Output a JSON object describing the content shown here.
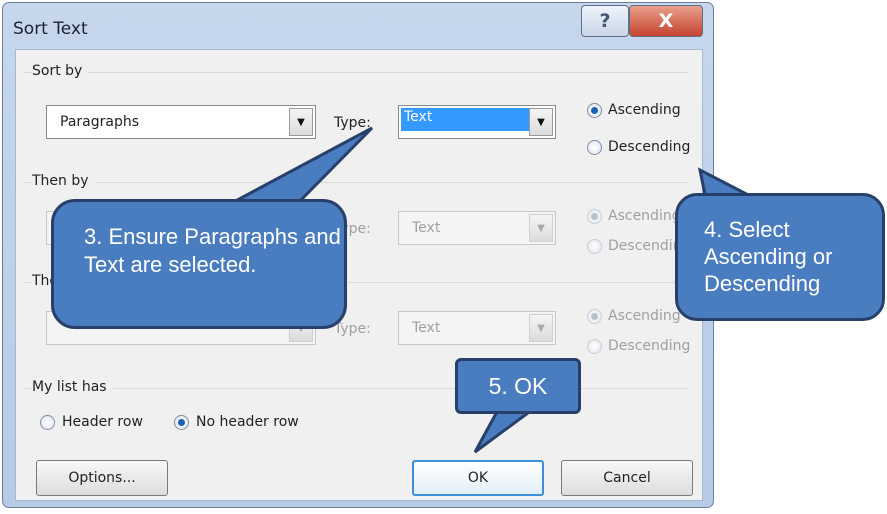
{
  "dialog": {
    "title": "Sort Text",
    "help_glyph": "?",
    "close_glyph": "X",
    "sort_by": {
      "label": "Sort by",
      "field_value": "Paragraphs",
      "type_label": "Type:",
      "type_value": "Text",
      "ascending_label": "Ascending",
      "descending_label": "Descending",
      "selected": "Ascending"
    },
    "then_by_1": {
      "label": "Then by",
      "field_value": "",
      "type_label": "Type:",
      "type_value": "Text",
      "ascending_label": "Ascending",
      "descending_label": "Descending"
    },
    "then_by_2": {
      "label": "Then by",
      "field_value": "",
      "type_label": "Type:",
      "type_value": "Text",
      "ascending_label": "Ascending",
      "descending_label": "Descending"
    },
    "list_has": {
      "label": "My list has",
      "header_row_label": "Header row",
      "no_header_row_label": "No header row",
      "selected": "No header row"
    },
    "buttons": {
      "options": "Options...",
      "ok": "OK",
      "cancel": "Cancel"
    }
  },
  "callouts": {
    "step3": "3. Ensure Paragraphs and Text are selected.",
    "step4": "4. Select Ascending or Descending",
    "step5": "5. OK"
  },
  "colors": {
    "callout_fill": "#4a7cc0",
    "callout_border": "#27406b",
    "selection_highlight": "#3399ff"
  }
}
